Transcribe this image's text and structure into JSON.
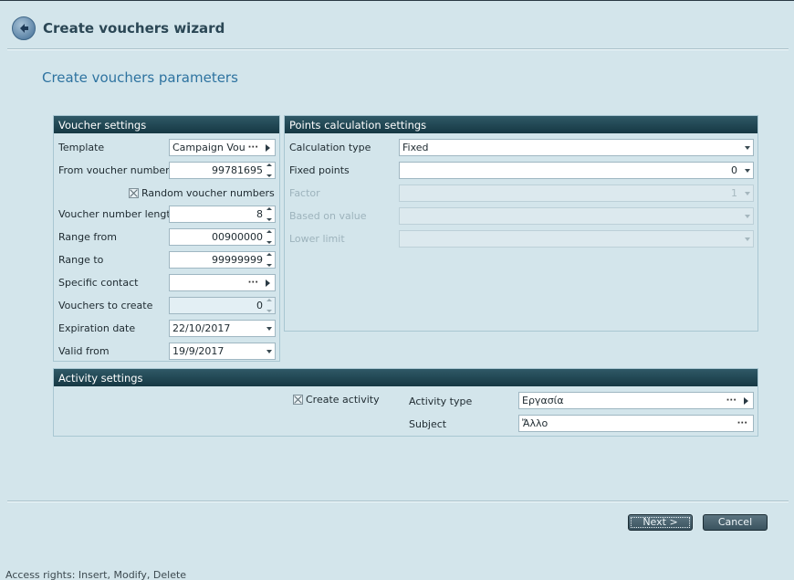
{
  "window": {
    "title": "Create vouchers wizard"
  },
  "page": {
    "subtitle": "Create vouchers parameters"
  },
  "voucher_settings": {
    "header": "Voucher settings",
    "template": {
      "label": "Template",
      "value": "Campaign Vouch",
      "dots": "···"
    },
    "from_voucher_number": {
      "label": "From voucher number",
      "value": "99781695"
    },
    "random_numbers": {
      "label": "Random voucher numbers",
      "checked": true
    },
    "number_length": {
      "label": "Voucher number length",
      "value": "8"
    },
    "range_from": {
      "label": "Range from",
      "value": "00900000"
    },
    "range_to": {
      "label": "Range to",
      "value": "99999999"
    },
    "specific_contact": {
      "label": "Specific contact",
      "value": "",
      "dots": "···"
    },
    "vouchers_to_create": {
      "label": "Vouchers to create",
      "value": "0"
    },
    "expiration_date": {
      "label": "Expiration date",
      "value": "22/10/2017"
    },
    "valid_from": {
      "label": "Valid from",
      "value": "19/9/2017"
    }
  },
  "points_settings": {
    "header": "Points calculation settings",
    "calculation_type": {
      "label": "Calculation type",
      "value": "Fixed"
    },
    "fixed_points": {
      "label": "Fixed points",
      "value": "0"
    },
    "factor": {
      "label": "Factor",
      "value": "1"
    },
    "based_on_value": {
      "label": "Based on value",
      "value": ""
    },
    "lower_limit": {
      "label": "Lower limit",
      "value": ""
    }
  },
  "activity_settings": {
    "header": "Activity settings",
    "create_activity": {
      "label": "Create activity",
      "checked": true
    },
    "activity_type": {
      "label": "Activity type",
      "value": "Εργασία",
      "dots": "···"
    },
    "subject": {
      "label": "Subject",
      "value": "Ἄλλο",
      "dots": "···"
    }
  },
  "footer": {
    "next_label": "Next >",
    "cancel_label": "Cancel",
    "status": "Access rights: Insert, Modify, Delete"
  },
  "colors": {
    "background": "#d3e5eb",
    "panel_header": "#1f4450",
    "accent_text": "#2e73a0"
  },
  "icons": [
    "back-arrow-icon",
    "spin-icon",
    "dropdown-icon",
    "ellipsis-icon",
    "play-arrow-icon",
    "checkbox-icon"
  ]
}
